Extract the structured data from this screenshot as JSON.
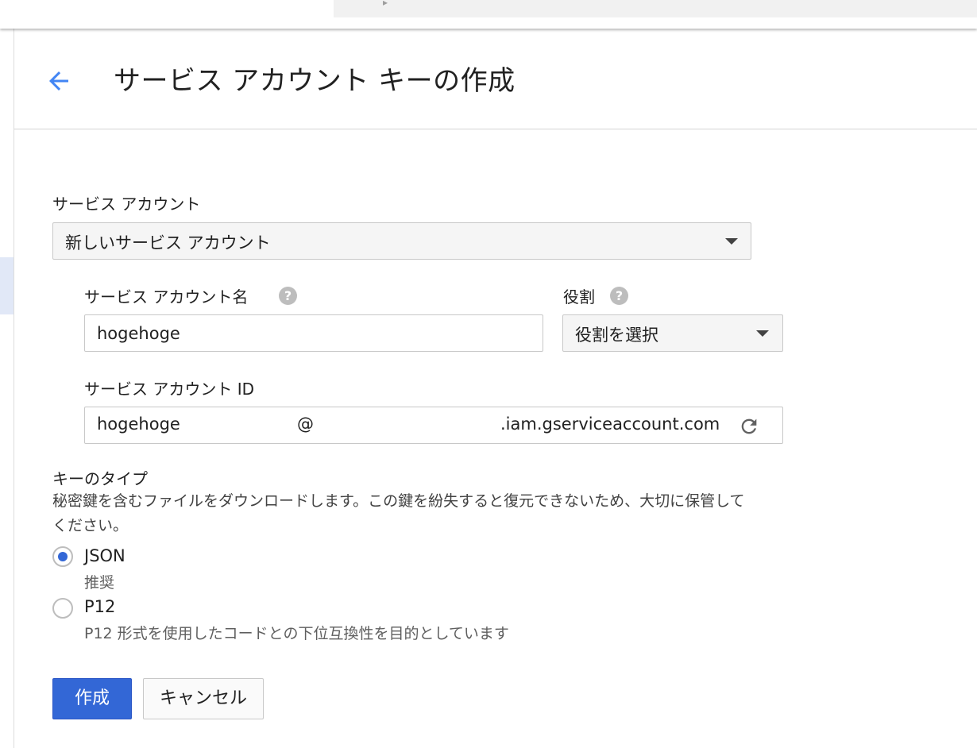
{
  "header": {
    "title": "サービス アカウント キーの作成",
    "back_icon": "arrow-back-icon",
    "accent_color": "#4285f4"
  },
  "service_account": {
    "label": "サービス アカウント",
    "selected": "新しいサービス アカウント"
  },
  "account_name": {
    "label": "サービス アカウント名",
    "value": "hogehoge",
    "help_icon": "?"
  },
  "role": {
    "label": "役割",
    "help_icon": "?",
    "selected": "役割を選択"
  },
  "account_id": {
    "label": "サービス アカウント ID",
    "value": "hogehoge",
    "at": "@",
    "domain": ".iam.gserviceaccount.com"
  },
  "key_type": {
    "title": "キーのタイプ",
    "description": "秘密鍵を含むファイルをダウンロードします。この鍵を紛失すると復元できないため、大切に保管してください。",
    "options": [
      {
        "label": "JSON",
        "sub": "推奨",
        "checked": true
      },
      {
        "label": "P12",
        "sub": "P12 形式を使用したコードとの下位互換性を目的としています",
        "checked": false
      }
    ]
  },
  "actions": {
    "create_label": "作成",
    "cancel_label": "キャンセル",
    "primary_color": "#3367d6"
  }
}
